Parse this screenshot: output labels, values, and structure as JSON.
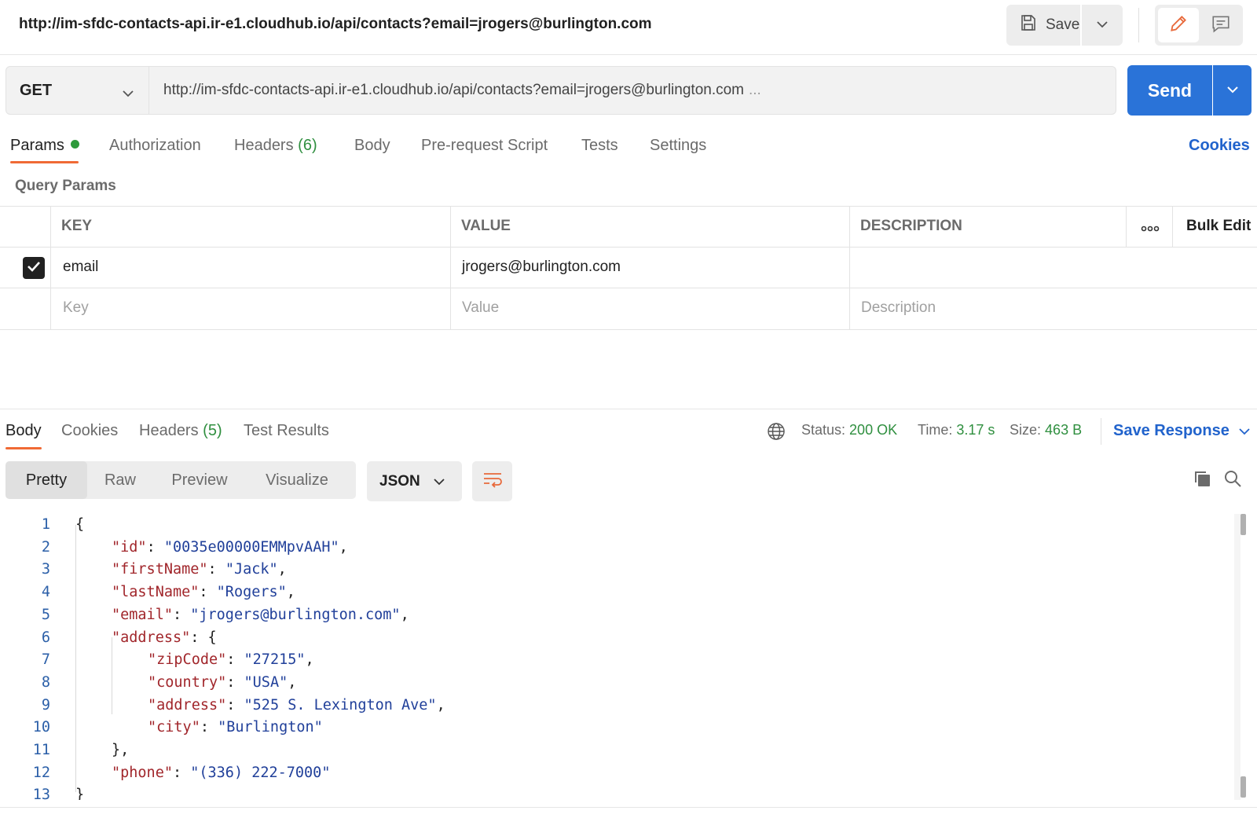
{
  "request": {
    "title": "http://im-sfdc-contacts-api.ir-e1.cloudhub.io/api/contacts?email=jrogers@burlington.com",
    "method": "GET",
    "url": "http://im-sfdc-contacts-api.ir-e1.cloudhub.io/api/contacts?email=jrogers@burlington.com",
    "url_ellipsis": "...",
    "save_label": "Save",
    "send_label": "Send"
  },
  "request_tabs": [
    {
      "label": "Params"
    },
    {
      "label": "Authorization"
    },
    {
      "label": "Headers",
      "count": "(6)"
    },
    {
      "label": "Body"
    },
    {
      "label": "Pre-request Script"
    },
    {
      "label": "Tests"
    },
    {
      "label": "Settings"
    }
  ],
  "cookies_label": "Cookies",
  "query_params": {
    "section_label": "Query Params",
    "headers": {
      "key": "KEY",
      "value": "VALUE",
      "description": "DESCRIPTION",
      "bulk_edit": "Bulk Edit"
    },
    "rows": [
      {
        "key": "email",
        "value": "jrogers@burlington.com",
        "description": "",
        "checked": true
      }
    ],
    "placeholders": {
      "key": "Key",
      "value": "Value",
      "description": "Description"
    }
  },
  "response_tabs": [
    {
      "label": "Body"
    },
    {
      "label": "Cookies"
    },
    {
      "label": "Headers",
      "count": "(5)"
    },
    {
      "label": "Test Results"
    }
  ],
  "response_meta": {
    "status_label": "Status:",
    "status_value": "200 OK",
    "time_label": "Time:",
    "time_value": "3.17 s",
    "size_label": "Size:",
    "size_value": "463 B",
    "save_response": "Save Response"
  },
  "view_modes": [
    "Pretty",
    "Raw",
    "Preview",
    "Visualize"
  ],
  "format": "JSON",
  "code_lines": [
    {
      "n": "1",
      "indent": 0,
      "text": "{"
    },
    {
      "n": "2",
      "indent": 1,
      "key": "\"id\"",
      "val": "\"0035e00000EMMpvAAH\"",
      "tail": ","
    },
    {
      "n": "3",
      "indent": 1,
      "key": "\"firstName\"",
      "val": "\"Jack\"",
      "tail": ","
    },
    {
      "n": "4",
      "indent": 1,
      "key": "\"lastName\"",
      "val": "\"Rogers\"",
      "tail": ","
    },
    {
      "n": "5",
      "indent": 1,
      "key": "\"email\"",
      "val": "\"jrogers@burlington.com\"",
      "tail": ","
    },
    {
      "n": "6",
      "indent": 1,
      "key": "\"address\"",
      "open": "{"
    },
    {
      "n": "7",
      "indent": 2,
      "key": "\"zipCode\"",
      "val": "\"27215\"",
      "tail": ","
    },
    {
      "n": "8",
      "indent": 2,
      "key": "\"country\"",
      "val": "\"USA\"",
      "tail": ","
    },
    {
      "n": "9",
      "indent": 2,
      "key": "\"address\"",
      "val": "\"525 S. Lexington Ave\"",
      "tail": ","
    },
    {
      "n": "10",
      "indent": 2,
      "key": "\"city\"",
      "val": "\"Burlington\"",
      "tail": ""
    },
    {
      "n": "11",
      "indent": 1,
      "text": "},"
    },
    {
      "n": "12",
      "indent": 1,
      "key": "\"phone\"",
      "val": "\"(336) 222-7000\"",
      "tail": ""
    },
    {
      "n": "13",
      "indent": 0,
      "text": "}"
    }
  ]
}
